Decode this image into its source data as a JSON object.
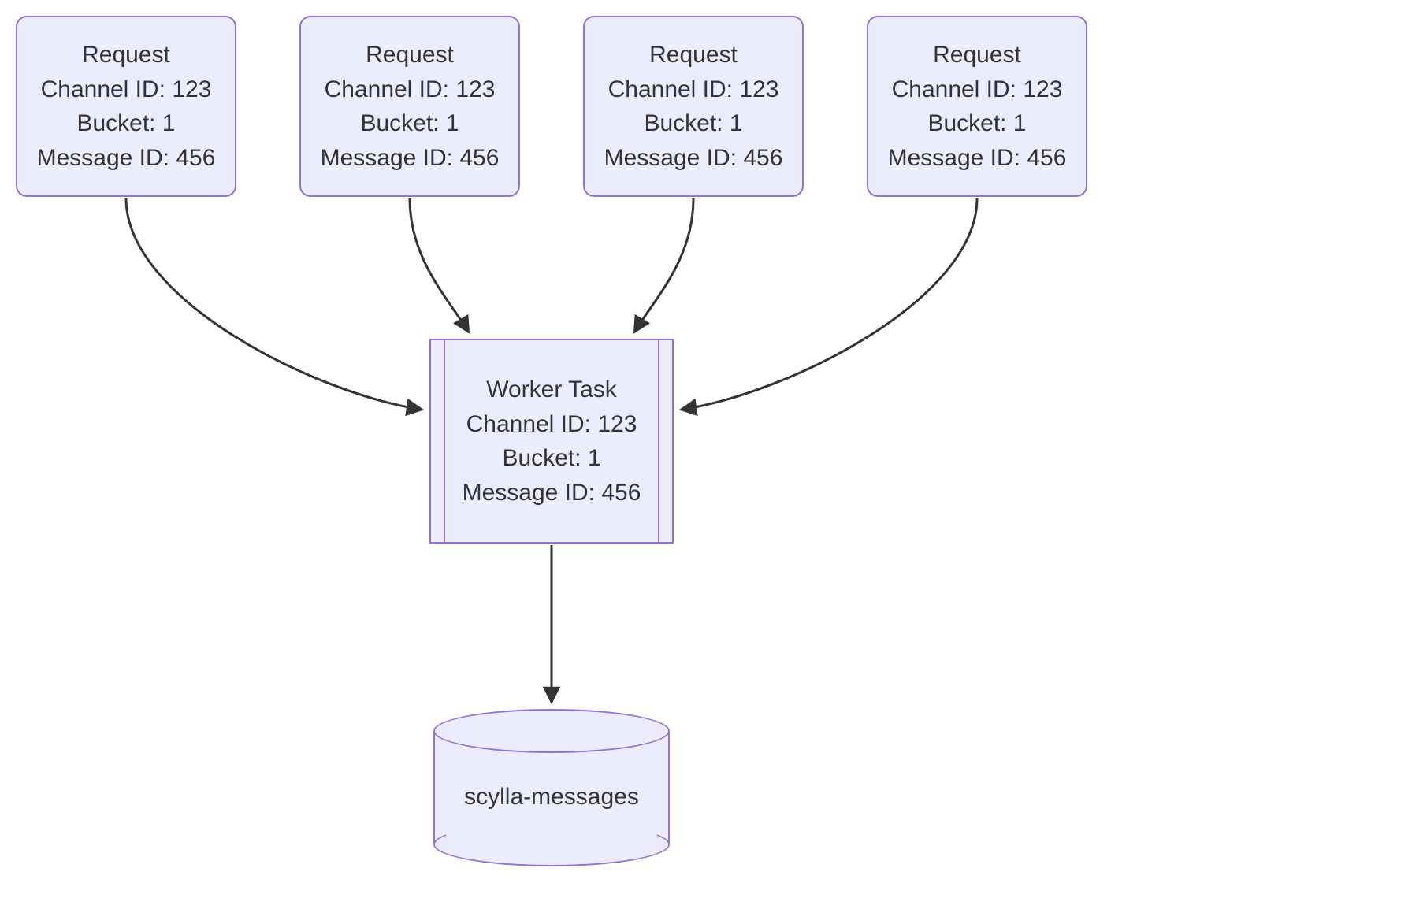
{
  "colors": {
    "node_fill": "#ECECFF",
    "node_stroke": "#9370DB",
    "edge_stroke": "#333333",
    "text": "#333333",
    "background": "#ffffff"
  },
  "requests": [
    {
      "title": "Request",
      "channel_label": "Channel ID: 123",
      "bucket_label": "Bucket: 1",
      "message_label": "Message ID: 456"
    },
    {
      "title": "Request",
      "channel_label": "Channel ID: 123",
      "bucket_label": "Bucket: 1",
      "message_label": "Message ID: 456"
    },
    {
      "title": "Request",
      "channel_label": "Channel ID: 123",
      "bucket_label": "Bucket: 1",
      "message_label": "Message ID: 456"
    },
    {
      "title": "Request",
      "channel_label": "Channel ID: 123",
      "bucket_label": "Bucket: 1",
      "message_label": "Message ID: 456"
    }
  ],
  "worker": {
    "title": "Worker Task",
    "channel_label": "Channel ID: 123",
    "bucket_label": "Bucket: 1",
    "message_label": "Message ID: 456"
  },
  "database": {
    "label": "scylla-messages"
  }
}
